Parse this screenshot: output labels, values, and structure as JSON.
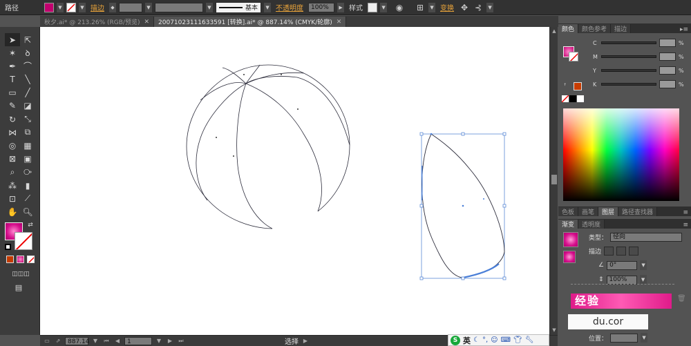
{
  "control_bar": {
    "object_type": "路径",
    "stroke_label": "描边",
    "opacity_label": "不透明度",
    "opacity_value": "100%",
    "style_label": "样式",
    "stroke_profile_label": "基本",
    "transform_label": "变换",
    "fill_color": "#c2006e"
  },
  "tabs": [
    {
      "title": "秋夕.ai* @ 213.26% (RGB/预览)",
      "close": "✕"
    },
    {
      "title": "20071023111633591 [转换].ai* @ 887.14% (CMYK/轮廓)",
      "close": "✕"
    }
  ],
  "status_bar": {
    "zoom": "887.14",
    "artboard": "1",
    "status_text": "选择"
  },
  "ime": {
    "logo": "S",
    "mode": "英"
  },
  "color_panel": {
    "tabs": [
      "颜色",
      "颜色参考",
      "描边"
    ],
    "channels": [
      {
        "letter": "C",
        "unit": "%"
      },
      {
        "letter": "M",
        "unit": "%"
      },
      {
        "letter": "Y",
        "unit": "%"
      },
      {
        "letter": "K",
        "unit": "%"
      }
    ]
  },
  "mid_panel": {
    "tabs": [
      "色板",
      "画笔",
      "图层",
      "路径查找器"
    ]
  },
  "gradient_panel": {
    "tabs": [
      "渐变",
      "透明度"
    ],
    "type_label": "类型：",
    "type_value": "径向",
    "stroke_label": "描边",
    "angle_value": "0°",
    "aspect_value": "100%",
    "location_label": "位置："
  },
  "watermark": {
    "text": "经验",
    "url": "du.cor"
  },
  "colors": {
    "accent_pink": "#d60f8c",
    "link_orange": "#e8a33a",
    "selection_blue": "#4a7fd8"
  }
}
